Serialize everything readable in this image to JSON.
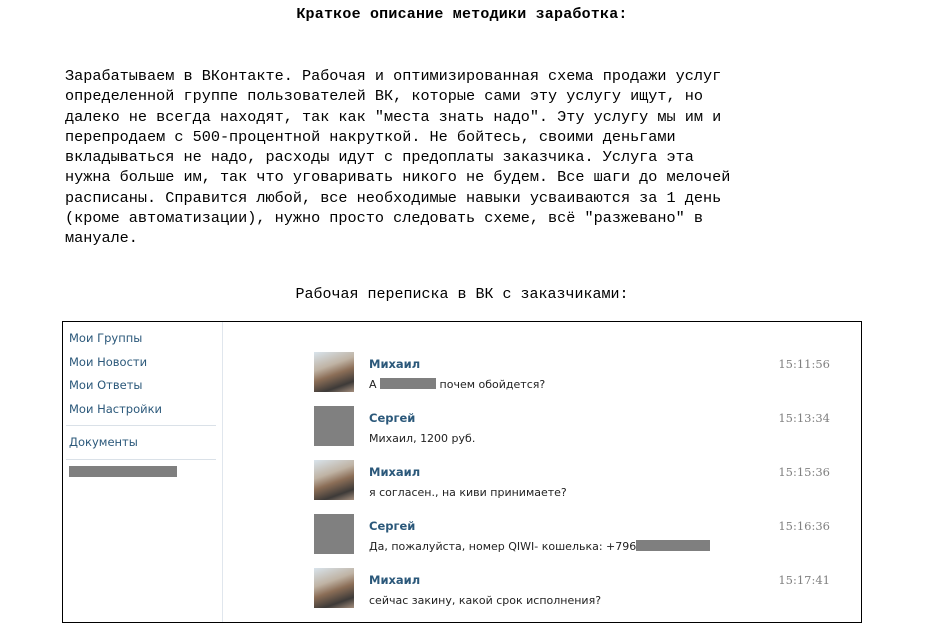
{
  "heading": "Краткое описание методики заработка:",
  "description_lines": [
    "Зарабатываем в ВКонтакте. Рабочая и оптимизированная схема продажи услуг",
    "определенной группе пользователей ВК, которые сами эту услугу ищут, но",
    "далеко не всегда находят, так как \"места знать надо\". Эту услугу мы им и",
    "перепродаем с 500-процентной накруткой. Не бойтесь, своими деньгами",
    "вкладываться не надо, расходы идут с предоплаты заказчика. Услуга эта",
    "нужна больше им, так что уговаривать никого не будем. Все шаги до мелочей",
    "расписаны. Справится любой, все необходимые навыки усваиваются за 1 день",
    "(кроме автоматизации), нужно просто следовать схеме, всё \"разжевано\" в",
    "мануале."
  ],
  "subheading": "Рабочая переписка в ВК с заказчиками:",
  "sidebar": {
    "items": [
      {
        "label": "Мои Группы"
      },
      {
        "label": "Мои Новости"
      },
      {
        "label": "Мои Ответы"
      },
      {
        "label": "Мои Настройки"
      }
    ],
    "documents_label": "Документы"
  },
  "messages": [
    {
      "author": "Михаил",
      "time": "15:11:56",
      "text_before": "А",
      "text_after": "почем обойдется?",
      "avatar": "photo"
    },
    {
      "author": "Сергей",
      "time": "15:13:34",
      "text_before": "Михаил, 1200 руб.",
      "text_after": "",
      "avatar": "grey"
    },
    {
      "author": "Михаил",
      "time": "15:15:36",
      "text_before": "я согласен., на киви принимаете?",
      "text_after": "",
      "avatar": "photo"
    },
    {
      "author": "Сергей",
      "time": "15:16:36",
      "text_before": "Да, пожалуйста, номер QIWI- кошелька: +796",
      "text_after": "",
      "avatar": "grey"
    },
    {
      "author": "Михаил",
      "time": "15:17:41",
      "text_before": "сейчас закину, какой срок исполнения?",
      "text_after": "",
      "avatar": "photo"
    }
  ]
}
